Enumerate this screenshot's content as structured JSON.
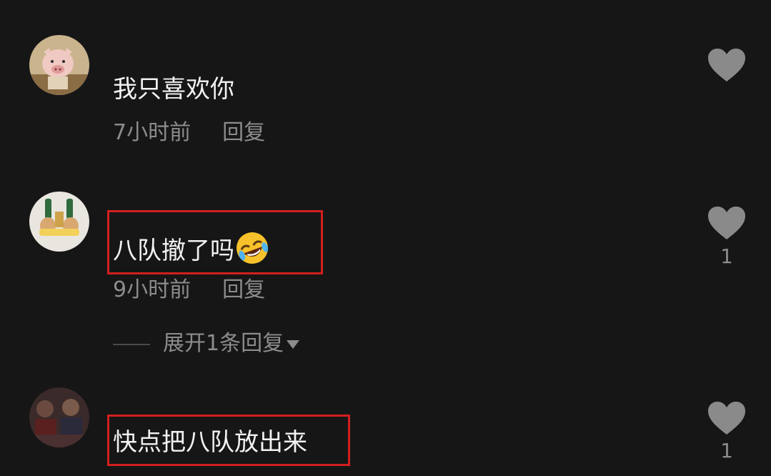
{
  "comments": [
    {
      "text": "我只喜欢你",
      "time": "7小时前",
      "reply": "回复",
      "likes": ""
    },
    {
      "text": "八队撤了吗",
      "emoji": "rofl-laughing-emoji",
      "time": "9小时前",
      "reply": "回复",
      "likes": "1",
      "expand_label": "展开1条回复"
    },
    {
      "text": "快点把八队放出来",
      "likes": "1"
    }
  ],
  "colors": {
    "background": "#161616",
    "highlight_border": "#d21f1f",
    "secondary_text": "#8c8c8c",
    "heart": "#8a8a8a"
  },
  "icons": [
    "heart-icon",
    "chevron-down-icon"
  ]
}
